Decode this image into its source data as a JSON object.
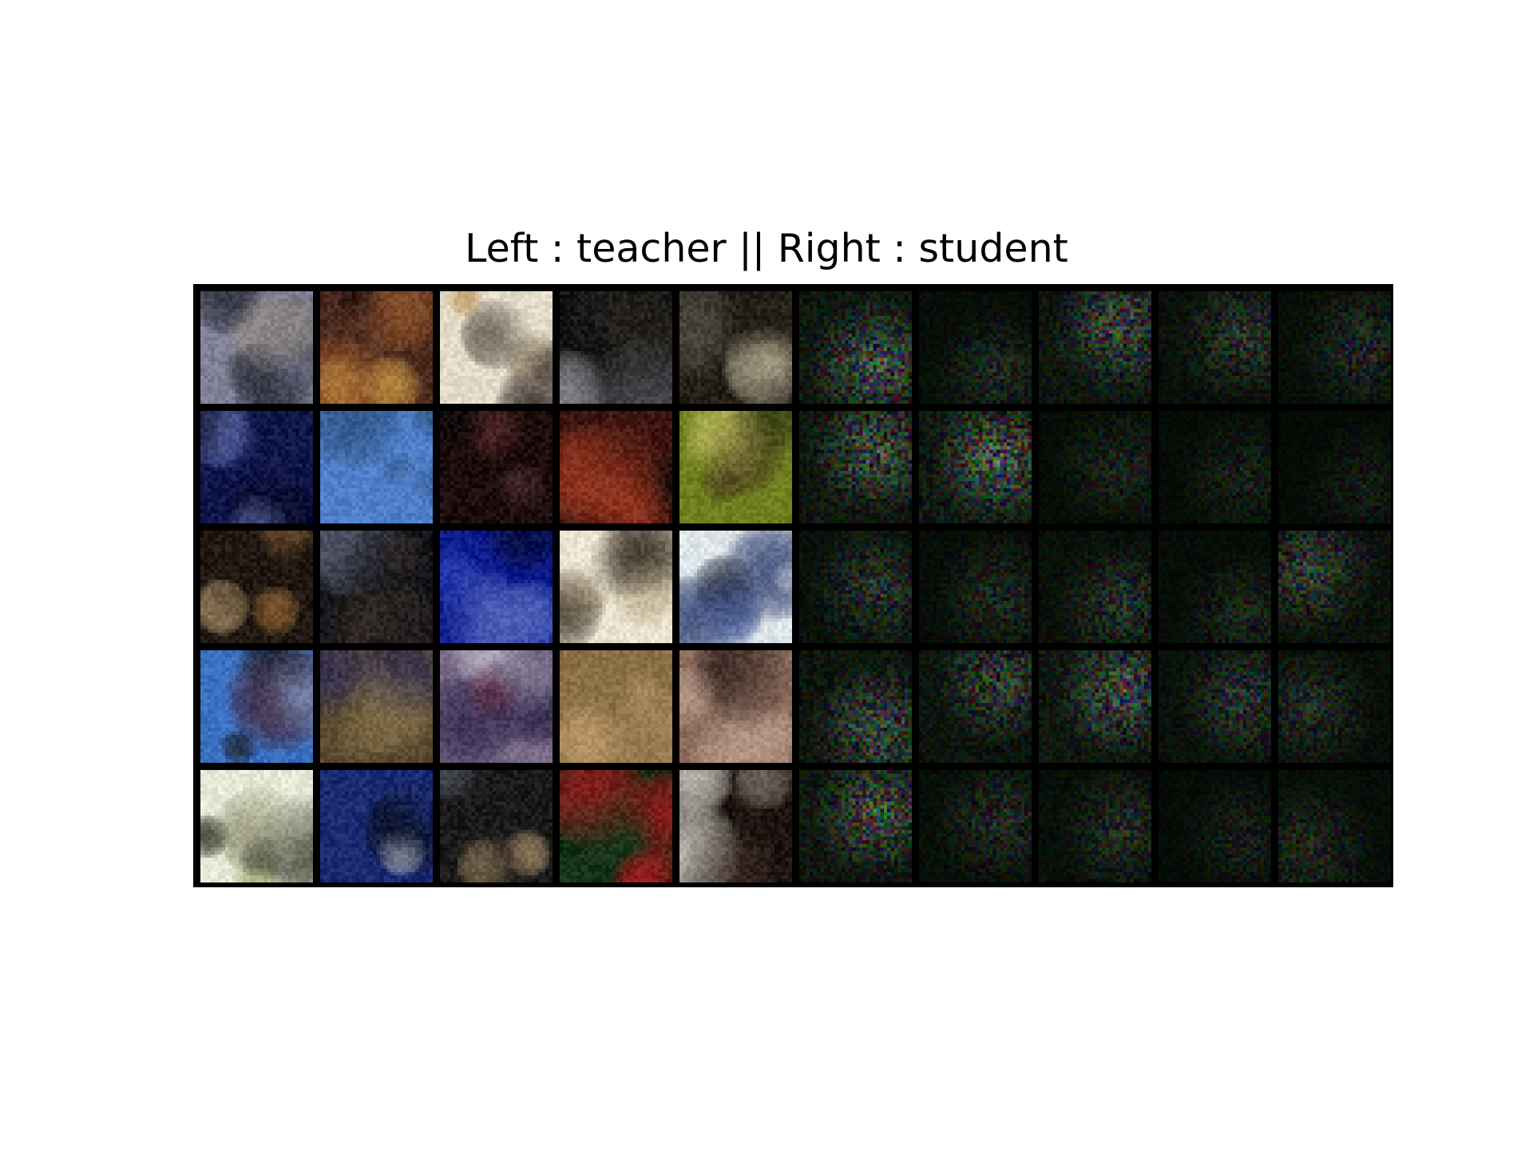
{
  "figure": {
    "title": "Left : teacher || Right : student"
  },
  "grid": {
    "rows": 5,
    "cols": 10,
    "teacher_cols": 5,
    "student_cols": 5,
    "border_color": "#000000"
  },
  "teacher_palettes": [
    [
      "#7f7f95",
      "#4a4d60",
      "#20222c",
      "#a39a8a"
    ],
    [
      "#4b2a1e",
      "#9a5a2f",
      "#d8a548",
      "#150d0b"
    ],
    [
      "#e3dcc8",
      "#b88d57",
      "#5b4430",
      "#201916"
    ],
    [
      "#141414",
      "#555862",
      "#a5a1a8",
      "#2a2620"
    ],
    [
      "#242018",
      "#8a7c4f",
      "#ddd2b0",
      "#4f4a42"
    ],
    [
      "#10154a",
      "#3148b0",
      "#7a8bd0",
      "#05071c"
    ],
    [
      "#4f7fc8",
      "#8fb6e8",
      "#131a24",
      "#2e4e7d"
    ],
    [
      "#1c0d0c",
      "#5a2a2a",
      "#7c4a5a",
      "#0a0507"
    ],
    [
      "#3c1510",
      "#a23a22",
      "#1f2a1a",
      "#0b0908"
    ],
    [
      "#6f7f20",
      "#c9c46a",
      "#4a3a1e",
      "#27300f"
    ],
    [
      "#201811",
      "#9a6b3a",
      "#d8b686",
      "#0c0907"
    ],
    [
      "#15151a",
      "#6f7790",
      "#3a2e24",
      "#050505"
    ],
    [
      "#0b1a8a",
      "#2a42b8",
      "#5a6ec0",
      "#050a30"
    ],
    [
      "#eae3cf",
      "#b9a889",
      "#2b2218",
      "#7a6a50"
    ],
    [
      "#dfe6ea",
      "#1a2a60",
      "#4c64a8",
      "#0a1024"
    ],
    [
      "#3b6fc0",
      "#8aa5d5",
      "#4a1818",
      "#1a1a22"
    ],
    [
      "#5a4a30",
      "#8f7a50",
      "#2c2a55",
      "#b0a590"
    ],
    [
      "#7a6c86",
      "#2a2148",
      "#6a2a3a",
      "#c0b8c8"
    ],
    [
      "#8a6f45",
      "#3b2a16",
      "#c5a070",
      "#1a130b"
    ],
    [
      "#8a6a5a",
      "#3a2220",
      "#c0a090",
      "#1a1010"
    ],
    [
      "#e5e8d5",
      "#9fa56a",
      "#1e2418",
      "#6a6a45"
    ],
    [
      "#1a2a70",
      "#3a7ad0",
      "#f0f0f0",
      "#0a1020"
    ],
    [
      "#1a1a1a",
      "#5a606a",
      "#b59a70",
      "#3a3028"
    ],
    [
      "#0f2a12",
      "#b0181e",
      "#e0e0e0",
      "#1c3a1c"
    ],
    [
      "#1c1410",
      "#6a3a28",
      "#eaeae0",
      "#3a2a20"
    ]
  ],
  "student_brightness": [
    0.95,
    0.45,
    0.85,
    0.6,
    0.5,
    0.9,
    1.0,
    0.4,
    0.35,
    0.3,
    0.6,
    0.45,
    0.55,
    0.4,
    0.7,
    0.85,
    0.75,
    0.9,
    0.6,
    0.5,
    0.9,
    0.5,
    0.5,
    0.35,
    0.45
  ]
}
